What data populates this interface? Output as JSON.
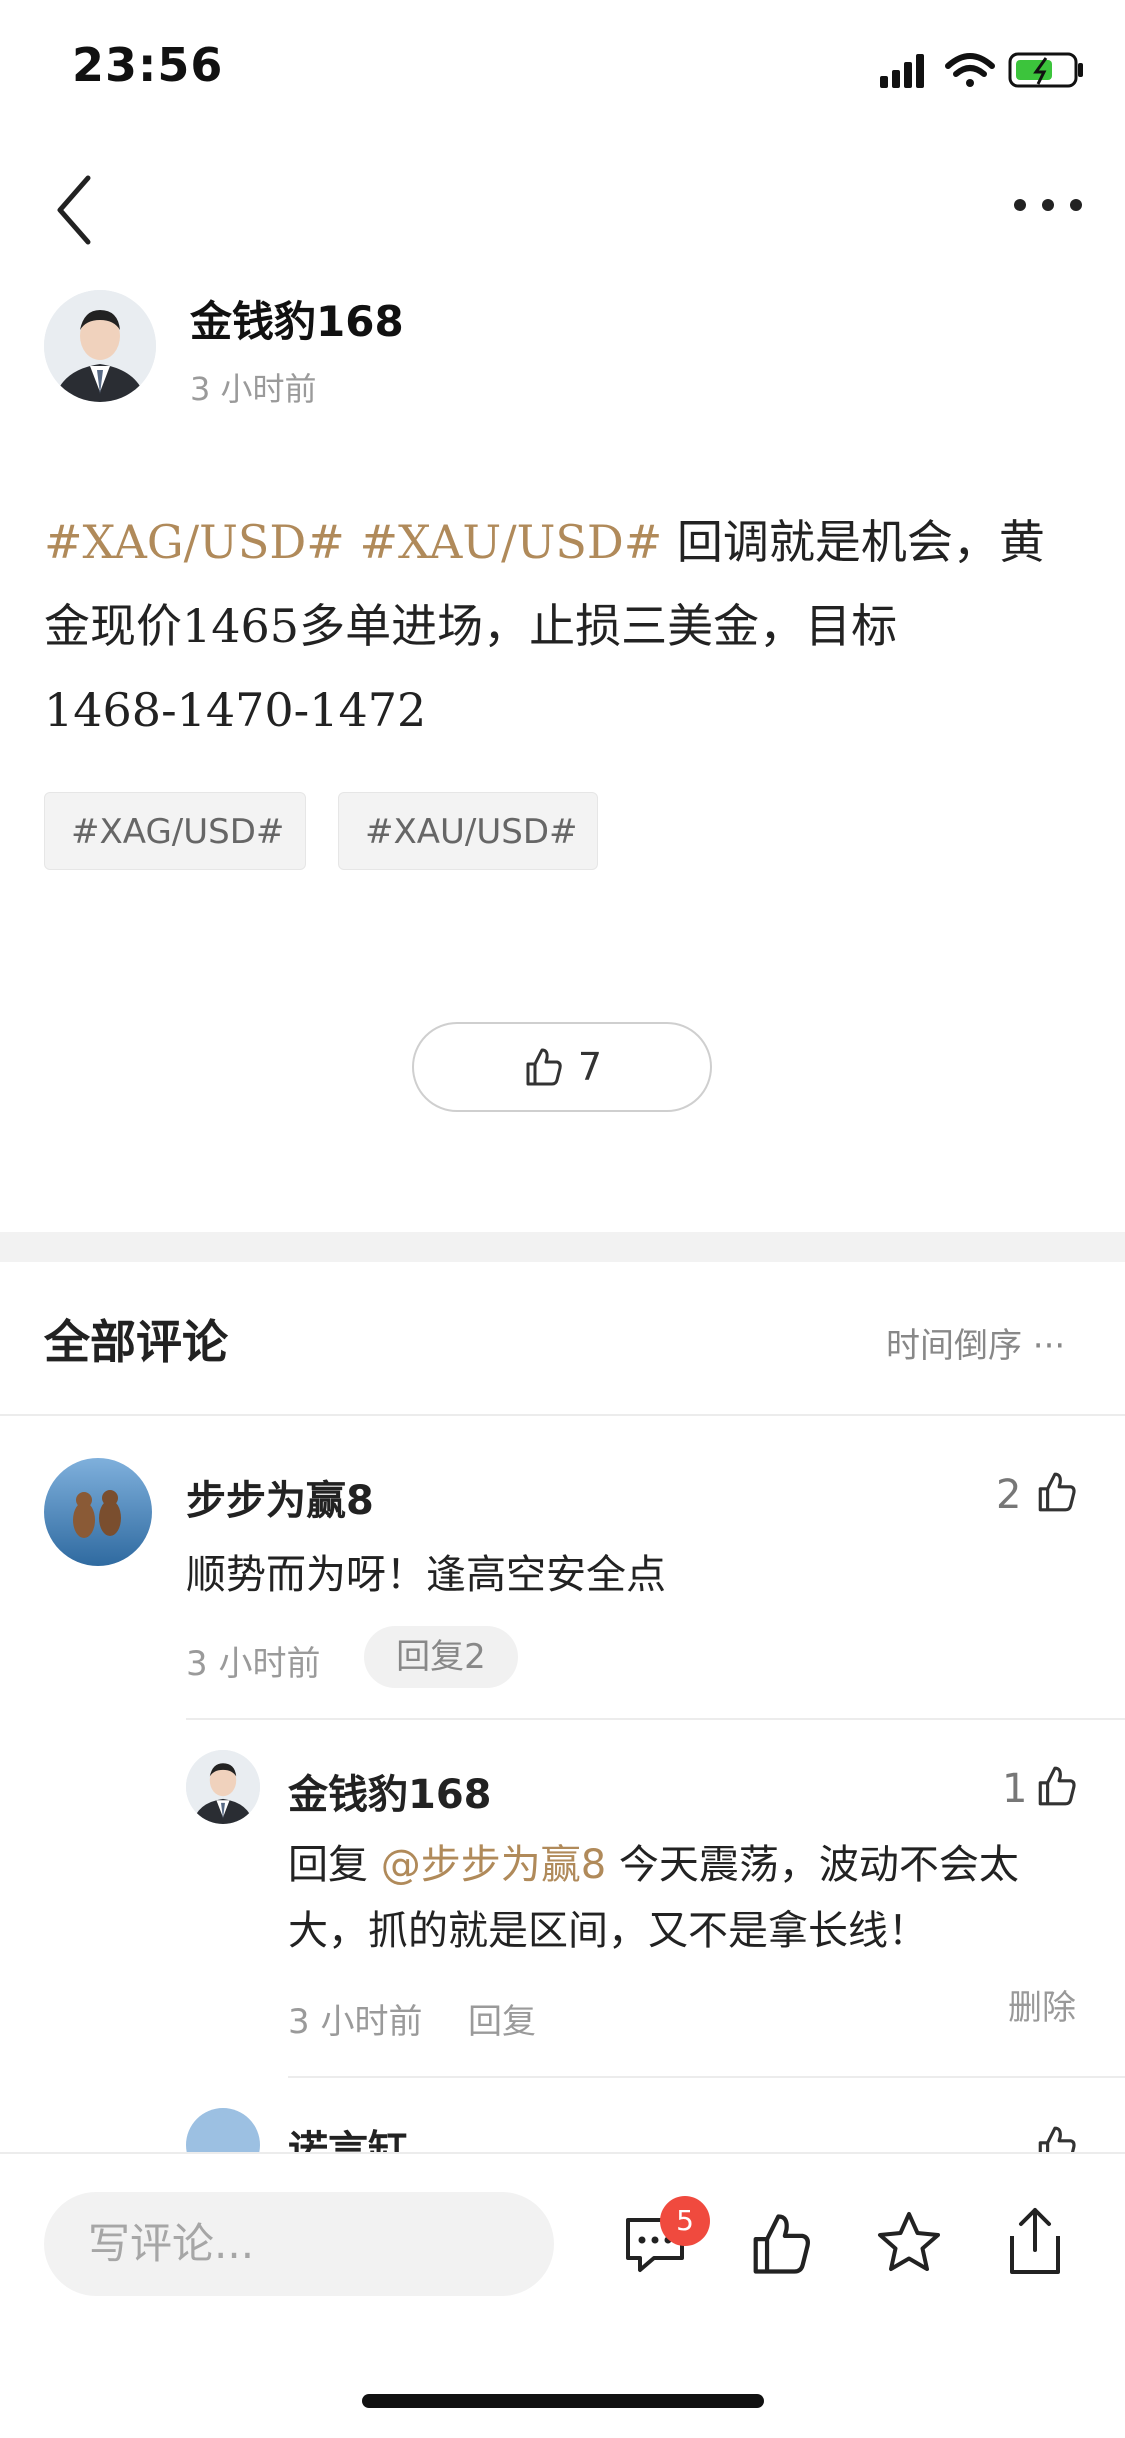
{
  "status_bar": {
    "time": "23:56"
  },
  "author": {
    "name": "金钱豹168",
    "time": "3 小时前"
  },
  "post": {
    "tag1": "#XAG/USD#",
    "tag2": "#XAU/USD#",
    "text_a": " 回调就是机会，黄金现价",
    "price": "1465",
    "text_b": "多单进场，止损三美金，目标",
    "targets": "1468-1470-1472",
    "chips": [
      "#XAG/USD#",
      "#XAU/USD#"
    ],
    "like_count": "7"
  },
  "comments_header": {
    "title": "全部评论",
    "sort_label": "时间倒序 ···"
  },
  "comments": [
    {
      "name": "步步为赢8",
      "text": "顺势而为呀！逢高空安全点",
      "time": "3 小时前",
      "reply_label": "回复2",
      "likes": "2"
    },
    {
      "name": "金钱豹168",
      "reply_prefix": "回复 ",
      "mention": "@步步为赢8",
      "text": " 今天震荡，波动不会太大，抓的就是区间，又不是拿长线！",
      "time": "3 小时前",
      "reply_label": "回复",
      "delete_label": "删除",
      "likes": "1"
    },
    {
      "name": "诺言缸"
    }
  ],
  "bottom_bar": {
    "input_placeholder": "写评论...",
    "comment_badge": "5"
  },
  "colors": {
    "accent": "#b08a5a",
    "badge": "#f04a3e"
  }
}
